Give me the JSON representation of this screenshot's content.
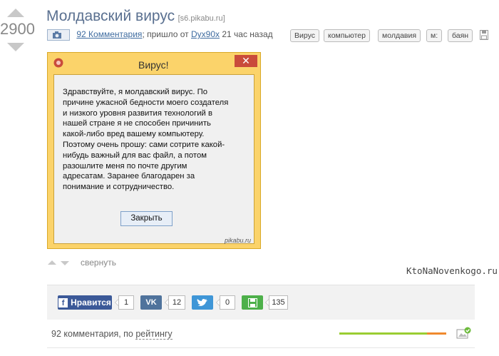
{
  "post": {
    "rating": "2900",
    "title": "Молдавский вирус",
    "domain": "[s6.pikabu.ru]",
    "meta": {
      "cam_sep": "–",
      "comments_link": "92 Комментария",
      "sep": ";",
      "posted_from": " пришло от ",
      "author": "Dyx90x",
      "time": " 21 час назад"
    },
    "tags": [
      "Вирус",
      "компьютер",
      "молдавия",
      "м:",
      "баян"
    ]
  },
  "dialog": {
    "title": "Вирус!",
    "close_glyph": "✕",
    "body": [
      "Здравствуйте, я молдавский вирус. По",
      "причине ужасной бедности моего создателя",
      "и низкого уровня развития технологий в",
      "нашей стране я не способен причинить",
      "какой-либо вред вашему компьютеру.",
      "Поэтому очень прошу: сами сотрите какой-",
      "нибудь важный для вас файл, а потом",
      "разошлите меня по почте другим",
      "адресатам. Заранее благодарен за",
      "понимание и сотрудничество."
    ],
    "button": "Закрыть",
    "watermark": "pikabu.ru"
  },
  "collapse_label": "свернуть",
  "site_watermark": "KtoNaNovenkogo.ru",
  "share": {
    "fb": {
      "label": "Нравится",
      "count": "1",
      "icon": "fb-icon"
    },
    "vk": {
      "label": "",
      "count": "12",
      "icon": "vk-icon"
    },
    "tw": {
      "label": "",
      "count": "0",
      "icon": "twitter-icon"
    },
    "save": {
      "label": "",
      "count": "135",
      "icon": "floppy-icon"
    }
  },
  "comments": {
    "count_text": "92 комментария, по ",
    "sort_label": "рейтингу"
  },
  "colors": {
    "title": "#5a7090",
    "fb": "#3b5998",
    "vk": "#4f739c",
    "tw": "#3f96d7",
    "save": "#4db04a",
    "dialog_frame": "#fbd36a",
    "rating_bar_green": "#9acd32",
    "rating_bar_orange": "#f08a2e"
  },
  "rating_bar": {
    "green_fraction": 0.82,
    "orange_fraction": 0.18
  }
}
